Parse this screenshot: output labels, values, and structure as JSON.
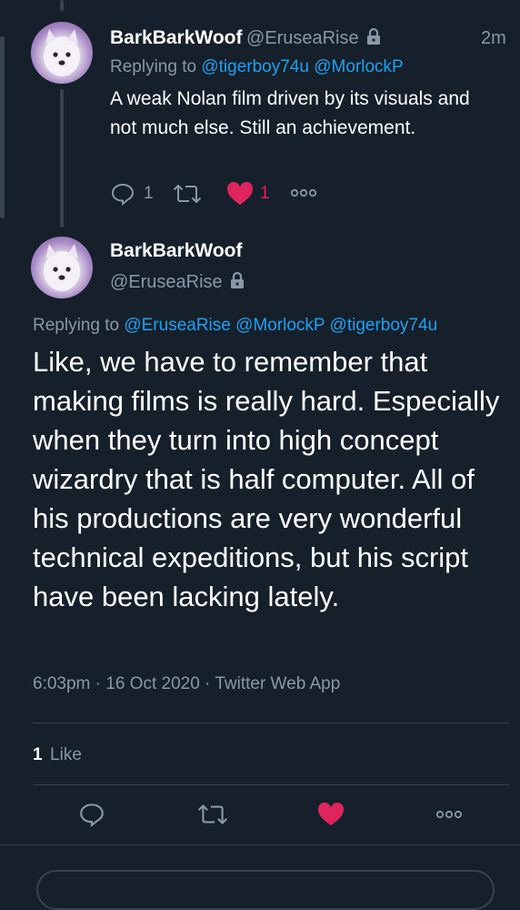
{
  "tweet_reply": {
    "author_name": "BarkBarkWoof",
    "author_handle": "@EruseaRise",
    "time_ago": "2m",
    "replying_prefix": "Replying to",
    "replying_to": [
      "@tigerboy74u",
      "@MorlockP"
    ],
    "text": "A weak Nolan film driven by its visuals and not much else.  Still an achievement.",
    "reply_count": "1",
    "like_count": "1"
  },
  "main_tweet": {
    "author_name": "BarkBarkWoof",
    "author_handle": "@EruseaRise",
    "replying_prefix": "Replying to",
    "replying_to": [
      "@EruseaRise",
      "@MorlockP",
      "@tigerboy74u"
    ],
    "text": "Like, we have to remember that making films is really hard. Especially when they turn into high concept wizardry that is half computer. All of his productions are very wonderful technical expeditions, but his script have been lacking lately.",
    "timestamp": "6:03pm · 16 Oct 2020 · Twitter Web App",
    "like_stat_count": "1",
    "like_stat_label": "Like"
  },
  "icons": {
    "lock": "lock-icon",
    "reply": "reply-icon",
    "retweet": "retweet-icon",
    "like": "heart-icon",
    "more": "more-icon"
  },
  "colors": {
    "background": "#15202b",
    "link": "#1da1f2",
    "muted": "#8899a6",
    "liked": "#e0245e",
    "divider": "#38444d"
  }
}
